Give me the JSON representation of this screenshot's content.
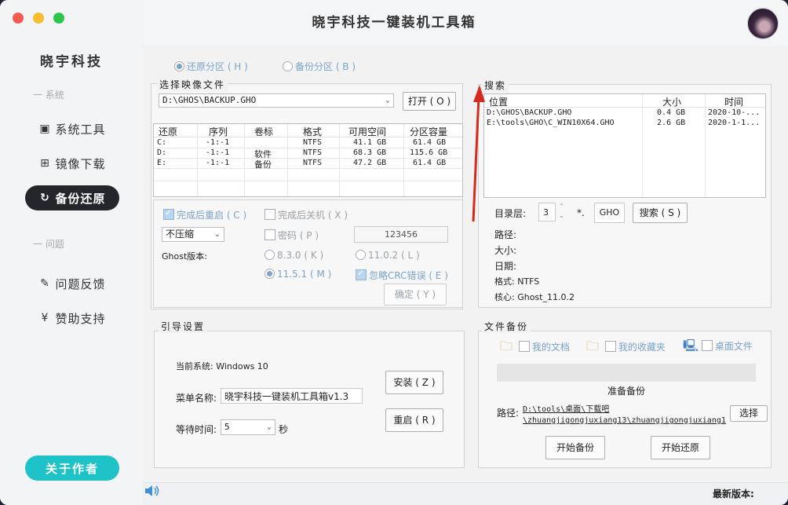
{
  "app": {
    "title": "晓宇科技一键装机工具箱",
    "brand": "晓宇科技"
  },
  "sidebar": {
    "section_system": "一 系统",
    "section_help": "一 问题",
    "items": [
      {
        "label": "系统工具",
        "icon": "toolbox-icon"
      },
      {
        "label": "镜像下载",
        "icon": "windows-icon"
      },
      {
        "label": "备份还原",
        "icon": "refresh-icon"
      },
      {
        "label": "问题反馈",
        "icon": "edit-icon"
      },
      {
        "label": "赞助支持",
        "icon": "yen-icon"
      }
    ],
    "about": "关于作者"
  },
  "mode": {
    "restore": "还原分区 ( H )",
    "backup": "备份分区 ( B )"
  },
  "image_file": {
    "legend": "选择映像文件",
    "path": "D:\\GHOS\\BACKUP.GHO",
    "open": "打开 ( O )"
  },
  "partitions": {
    "headers": [
      "还原",
      "序列",
      "卷标",
      "格式",
      "可用空间",
      "分区容量"
    ],
    "rows": [
      [
        "C:",
        "-1:-1",
        "",
        "NTFS",
        "41.1 GB",
        "61.4 GB"
      ],
      [
        "D:",
        "-1:-1",
        "软件",
        "NTFS",
        "68.3 GB",
        "115.6 GB"
      ],
      [
        "E:",
        "-1:-1",
        "备份",
        "NTFS",
        "47.2 GB",
        "61.4 GB"
      ]
    ]
  },
  "options": {
    "reboot_after": "完成后重启 ( C )",
    "shutdown_after": "完成后关机 ( X )",
    "compress": "不压缩",
    "password": "密码 ( P )",
    "password_value": "123456",
    "ghost_version_label": "Ghost版本:",
    "v830": "8.3.0 ( K )",
    "v1102": "11.0.2 ( L )",
    "v1151": "11.5.1 ( M )",
    "ignore_crc": "忽略CRC错误 ( E )",
    "confirm": "确定 ( Y )"
  },
  "search": {
    "legend": "搜索",
    "headers": [
      "位置",
      "大小",
      "时间"
    ],
    "rows": [
      [
        "D:\\GHOS\\BACKUP.GHO",
        "0.4 GB",
        "2020-10-..."
      ],
      [
        "E:\\tools\\GHO\\C_WIN10X64.GHO",
        "2.6 GB",
        "2020-1-1..."
      ]
    ],
    "depth_label": "目录层:",
    "depth_value": "3",
    "ext_prefix": "*.",
    "ext_value": "GHO",
    "search_button": "搜索 ( S )",
    "path_label": "路径:",
    "size_label": "大小:",
    "date_label": "日期:",
    "format_label": "格式: NTFS",
    "core_label": "核心: Ghost_11.0.2"
  },
  "boot": {
    "legend": "引导设置",
    "current_system": "当前系统: Windows 10",
    "menu_label": "菜单名称:",
    "menu_value": "晓宇科技一键装机工具箱v1.3",
    "wait_label": "等待时间:",
    "wait_value": "5",
    "wait_unit": "秒",
    "install": "安装 ( Z )",
    "reboot": "重启 ( R )"
  },
  "file_backup": {
    "legend": "文件备份",
    "my_docs": "我的文档",
    "my_favorites": "我的收藏夹",
    "desktop_files": "桌面文件",
    "status": "准备备份",
    "path_label": "路径:",
    "path_line1": "D:\\tools\\桌面\\下载吧",
    "path_line2": "\\zhuangjigongjuxiang13\\zhuangjigongjuxiang1",
    "choose": "选择",
    "start_backup": "开始备份",
    "start_restore": "开始还原"
  },
  "footer": {
    "latest_version": "最新版本:"
  },
  "colors": {
    "accent": "#1dc3c6",
    "active_nav": "#24262b",
    "arrow": "#d42a1f"
  }
}
